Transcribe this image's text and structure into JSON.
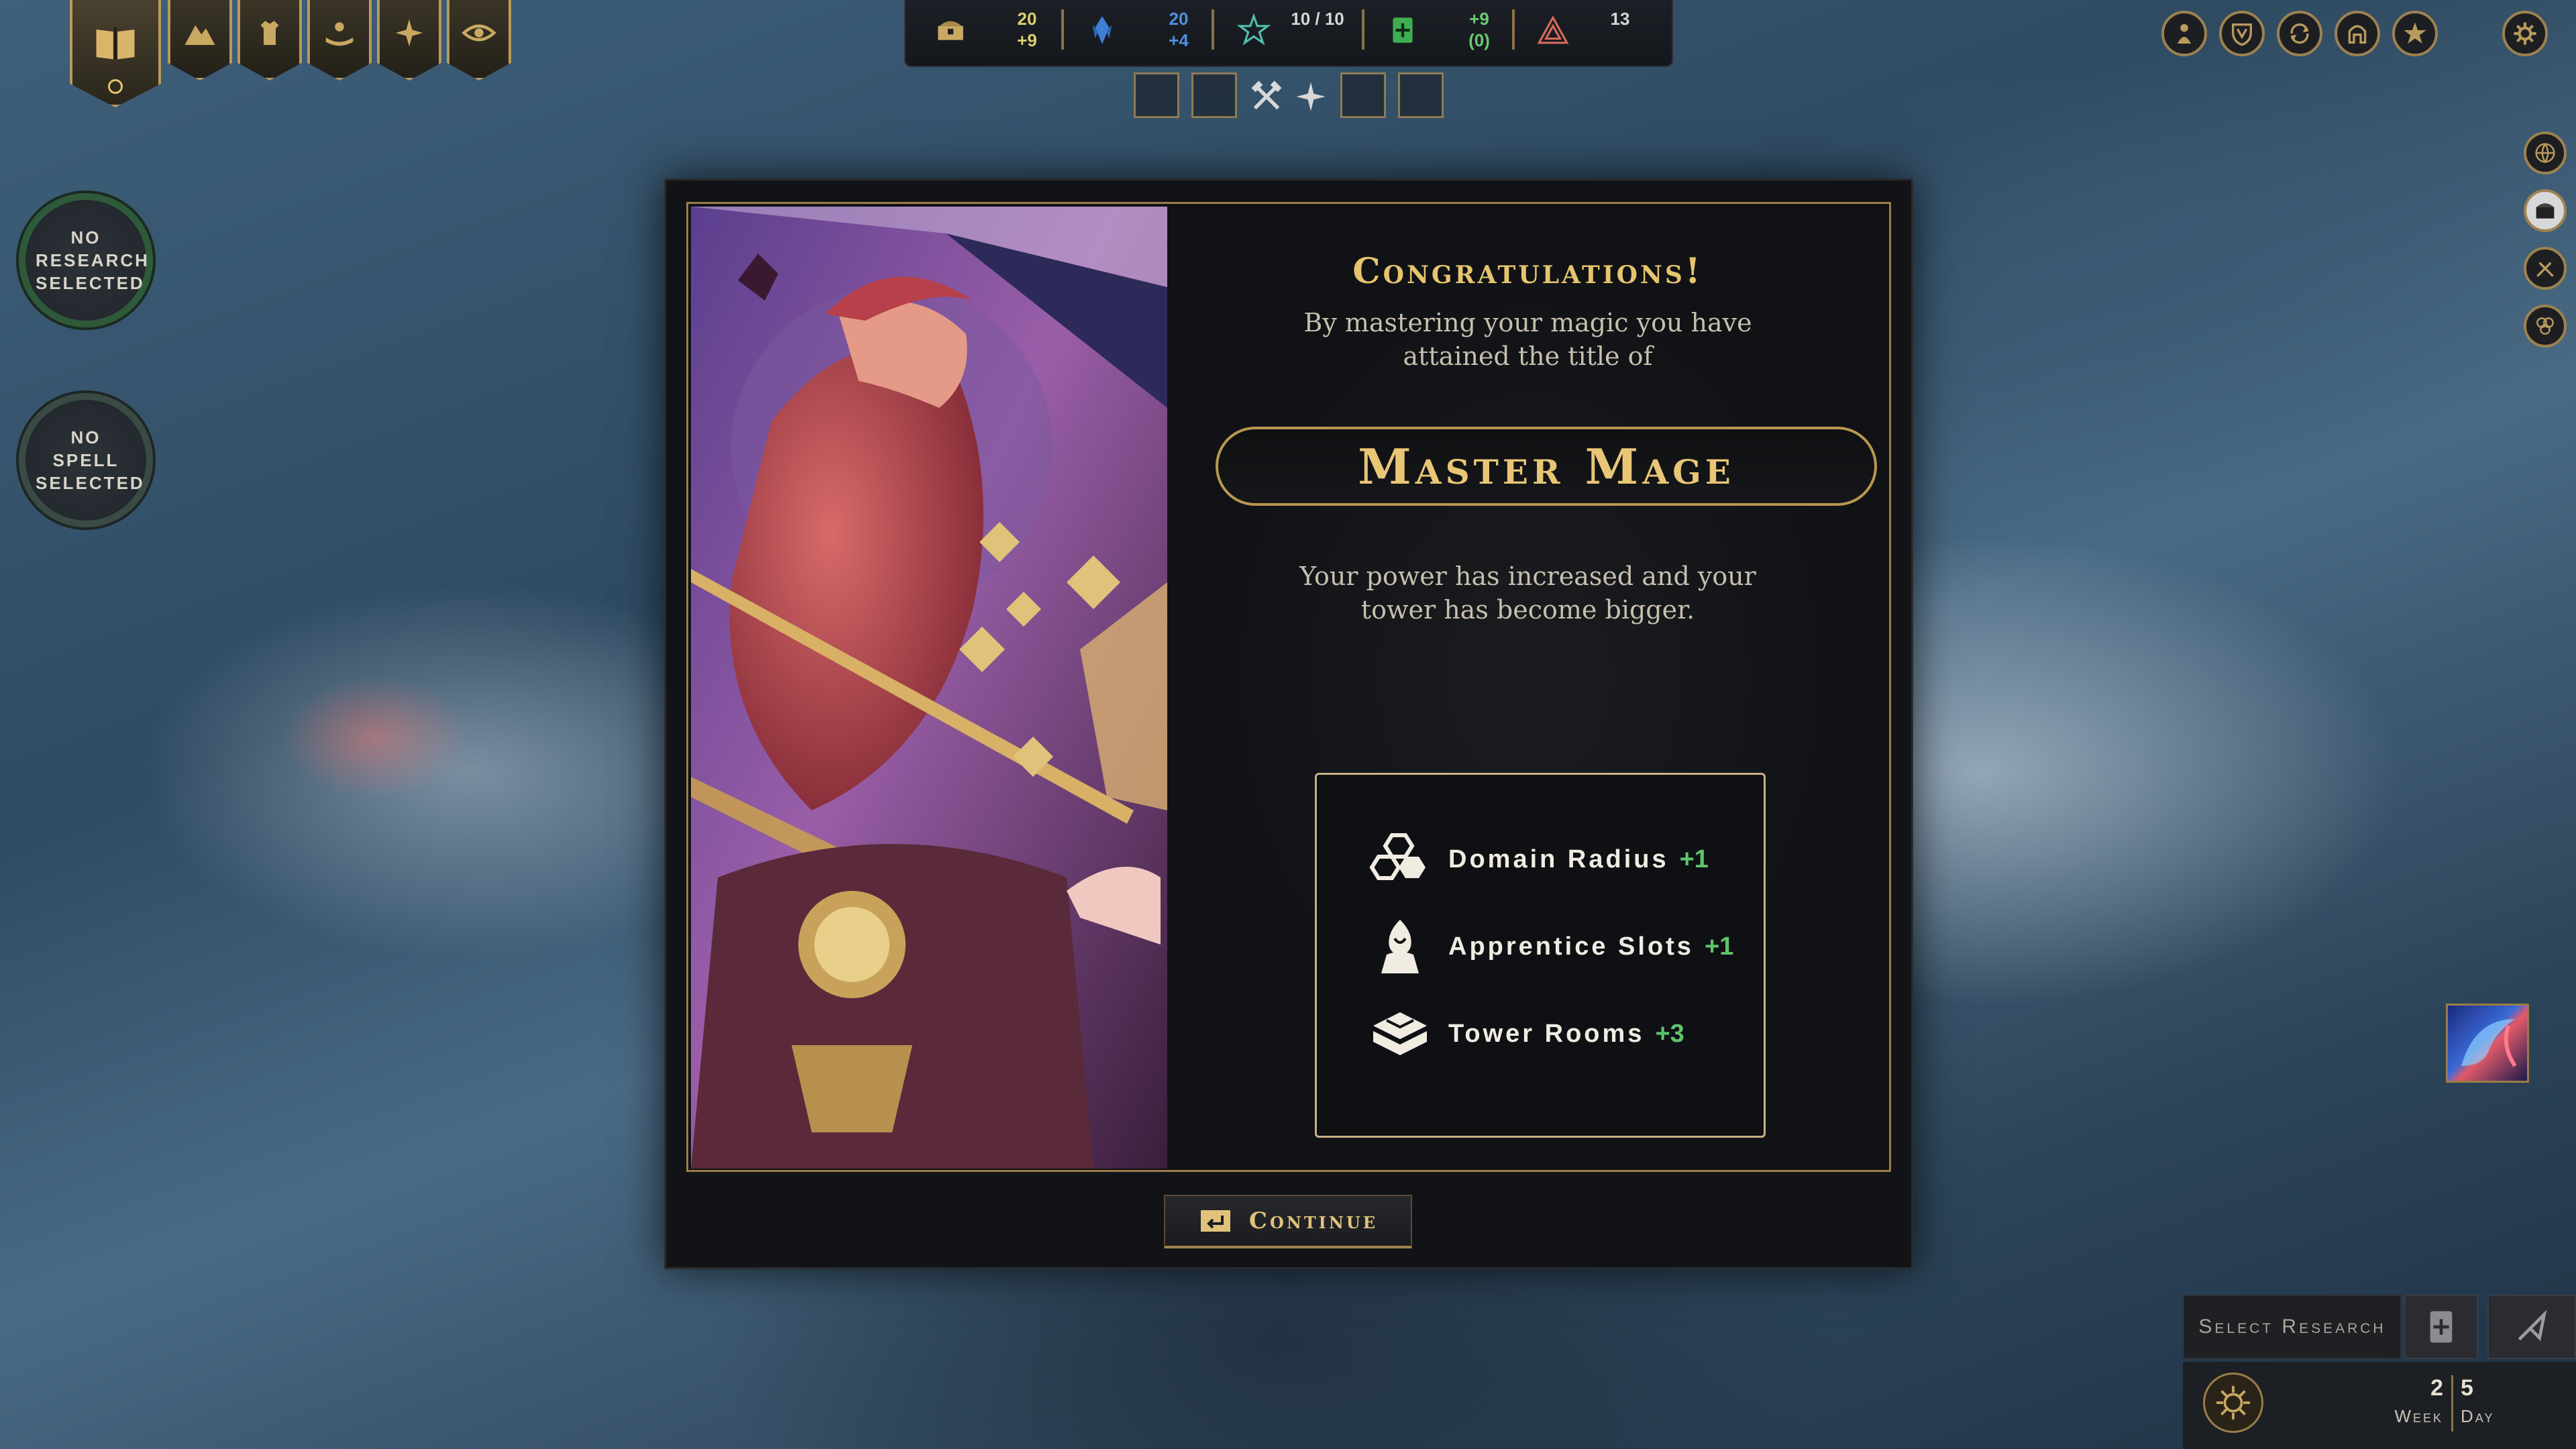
{
  "top_left_tabs": [
    {
      "name": "spellbook",
      "active": true
    },
    {
      "name": "domain"
    },
    {
      "name": "tower"
    },
    {
      "name": "apprentices"
    },
    {
      "name": "fleur"
    },
    {
      "name": "eye"
    }
  ],
  "resources": {
    "gold": {
      "amount": "20",
      "income": "+9"
    },
    "mana": {
      "amount": "20",
      "income": "+4"
    },
    "essence": {
      "amount": "10 / 10"
    },
    "research": {
      "income": "+9",
      "extra": "(0)"
    },
    "knowledge": {
      "amount": "13"
    }
  },
  "side_buttons": {
    "research": "No Research Selected",
    "spell": "No Spell Selected"
  },
  "modal": {
    "heading": "Congratulations!",
    "intro": "By mastering your magic you have attained the title of",
    "title": "Master Mage",
    "description": "Your power has increased and your tower has become bigger.",
    "rewards": [
      {
        "icon": "domain-radius-icon",
        "label": "Domain Radius",
        "bonus": "+1"
      },
      {
        "icon": "apprentice-icon",
        "label": "Apprentice Slots",
        "bonus": "+1"
      },
      {
        "icon": "tower-rooms-icon",
        "label": "Tower Rooms",
        "bonus": "+3"
      }
    ],
    "continue_label": "Continue"
  },
  "bottom_right": {
    "select_research": "Select Research",
    "week_value": "2",
    "week_label": "Week",
    "day_value": "5",
    "day_label": "Day"
  },
  "colors": {
    "gold_accent": "#e6c46e",
    "bonus_green": "#5ec46c",
    "panel_dark": "#111317",
    "frame_gold": "#9a7d48"
  }
}
